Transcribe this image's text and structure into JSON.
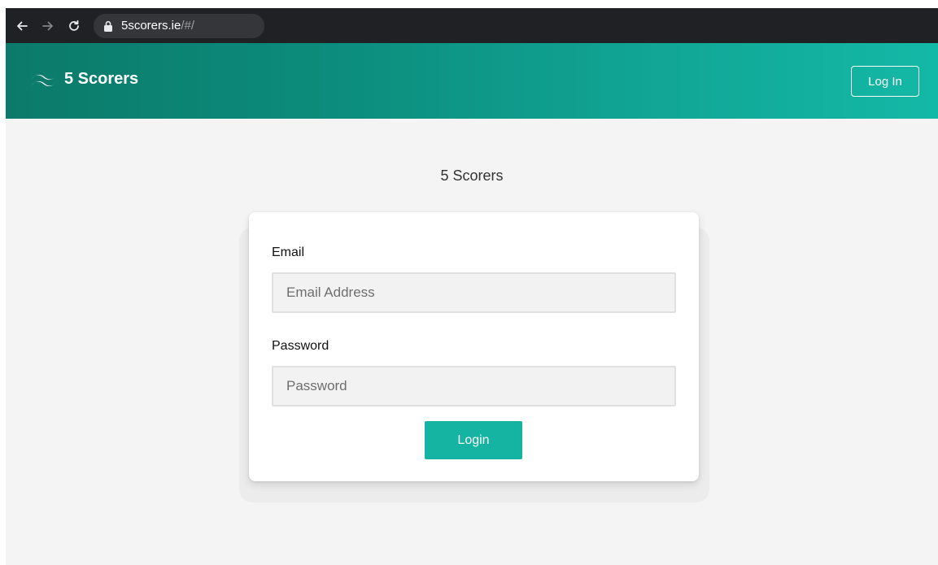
{
  "browser": {
    "url_host": "5scorers.ie",
    "url_path": "/#/"
  },
  "header": {
    "brand": "5 Scorers",
    "login_link": "Log In"
  },
  "main": {
    "title": "5 Scorers",
    "form": {
      "email_label": "Email",
      "email_placeholder": "Email Address",
      "email_value": "",
      "password_label": "Password",
      "password_placeholder": "Password",
      "password_value": "",
      "submit_label": "Login"
    }
  },
  "colors": {
    "header_gradient_start": "#0c7a6a",
    "header_gradient_end": "#14b8a6",
    "button": "#14b3a2",
    "page_background": "#f4f4f4"
  },
  "icons": [
    "back-arrow-icon",
    "forward-arrow-icon",
    "reload-icon",
    "lock-icon",
    "wave-logo-icon"
  ]
}
